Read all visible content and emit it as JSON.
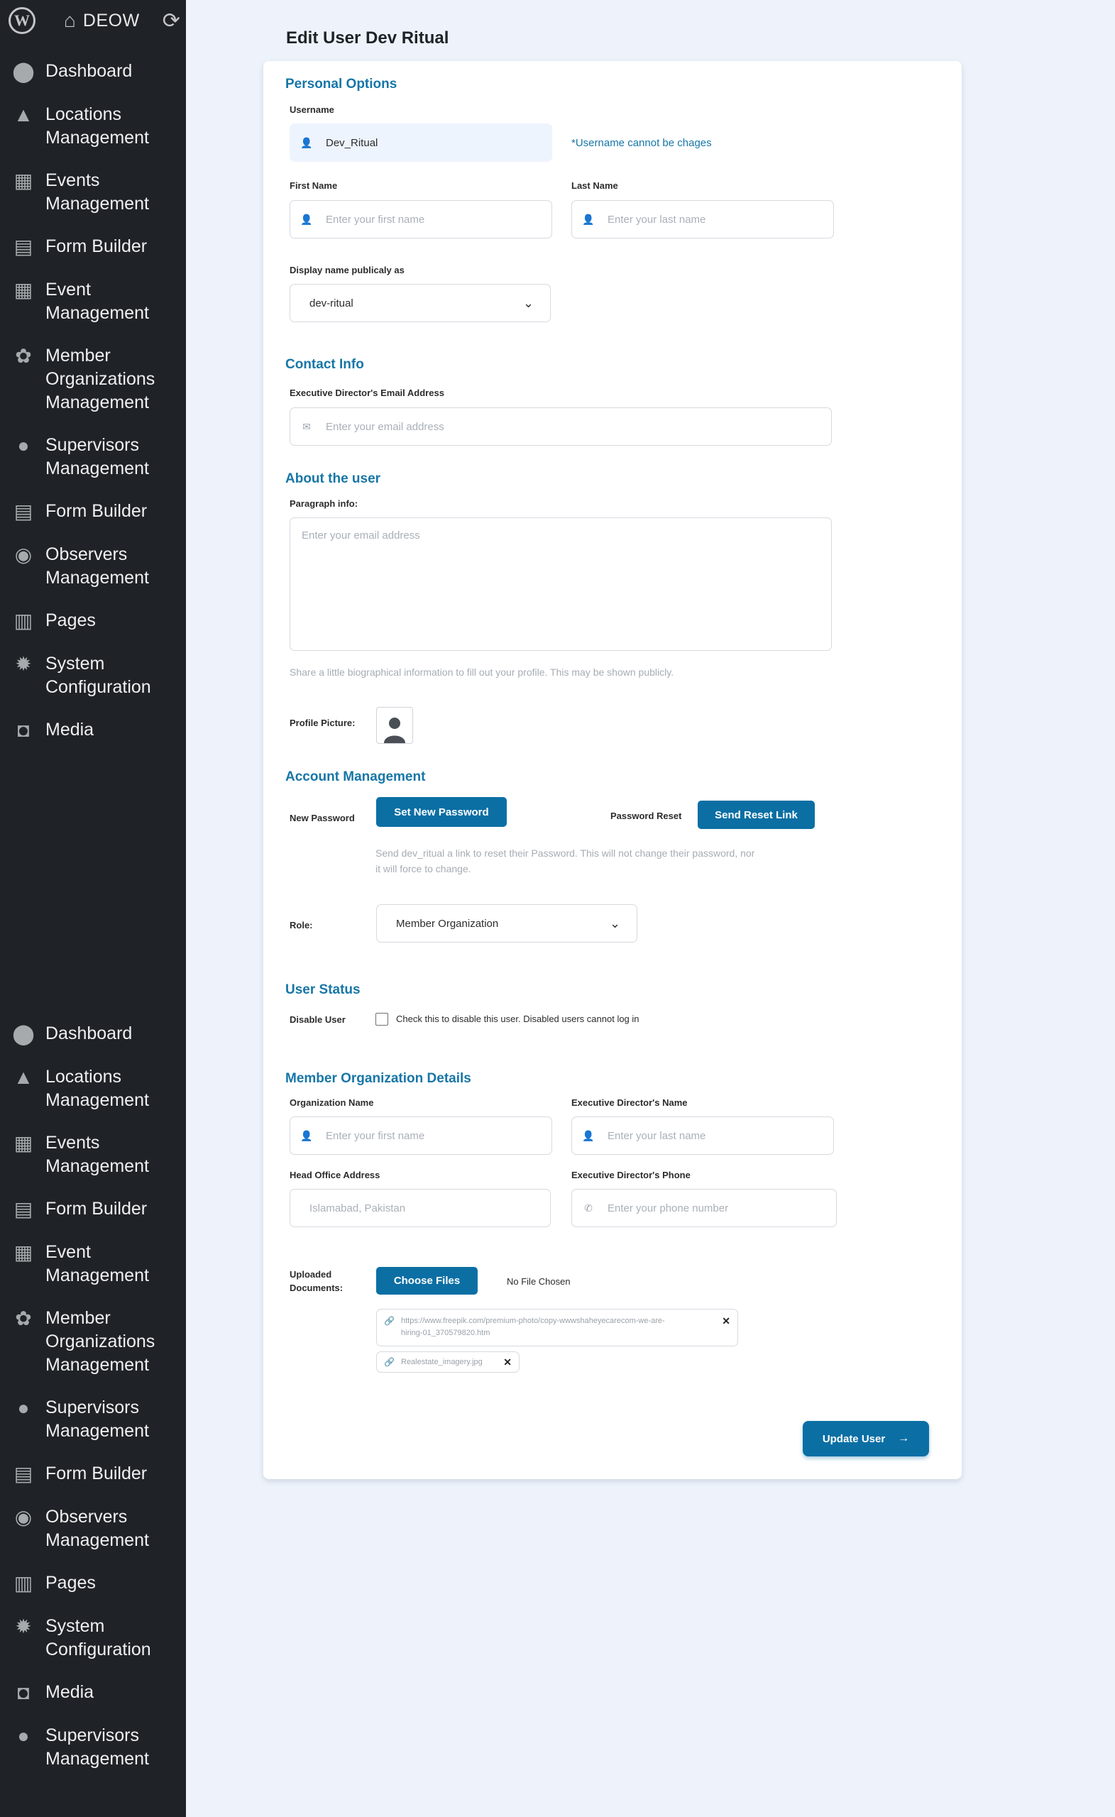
{
  "topbar": {
    "site_name": "DEOW",
    "wp_logo": "W"
  },
  "sidebar": {
    "items": [
      {
        "icon": "⬤",
        "label": "Dashboard"
      },
      {
        "icon": "▲",
        "label": "Locations\nManagement"
      },
      {
        "icon": "▦",
        "label": "Events\nManagement"
      },
      {
        "icon": "▤",
        "label": "Form Builder"
      },
      {
        "icon": "▦",
        "label": "Event\nManagement"
      },
      {
        "icon": "✿",
        "label": "Member\nOrganizations\nManagement"
      },
      {
        "icon": "●",
        "label": "Supervisors\nManagement"
      },
      {
        "icon": "▤",
        "label": "Form Builder"
      },
      {
        "icon": "◉",
        "label": "Observers\nManagement"
      },
      {
        "icon": "▥",
        "label": "Pages"
      },
      {
        "icon": "✹",
        "label": "System\nConfiguration"
      },
      {
        "icon": "◘",
        "label": "Media"
      }
    ],
    "items2": [
      {
        "icon": "⬤",
        "label": "Dashboard"
      },
      {
        "icon": "▲",
        "label": "Locations\nManagement"
      },
      {
        "icon": "▦",
        "label": "Events\nManagement"
      },
      {
        "icon": "▤",
        "label": "Form Builder"
      },
      {
        "icon": "▦",
        "label": "Event\nManagement"
      },
      {
        "icon": "✿",
        "label": "Member\nOrganizations\nManagement"
      },
      {
        "icon": "●",
        "label": "Supervisors\nManagement"
      },
      {
        "icon": "▤",
        "label": "Form Builder"
      },
      {
        "icon": "◉",
        "label": "Observers\nManagement"
      },
      {
        "icon": "▥",
        "label": "Pages"
      },
      {
        "icon": "✹",
        "label": "System\nConfiguration"
      },
      {
        "icon": "◘",
        "label": "Media"
      },
      {
        "icon": "●",
        "label": "Supervisors\nManagement"
      }
    ]
  },
  "page": {
    "title": "Edit User Dev Ritual"
  },
  "personal": {
    "heading": "Personal Options",
    "username_label": "Username",
    "username_value": "Dev_Ritual",
    "username_note": "*Username cannot be chages",
    "first_name_label": "First Name",
    "first_name_placeholder": "Enter your first name",
    "last_name_label": "Last Name",
    "last_name_placeholder": "Enter your last name",
    "display_name_label": "Display name publicaly as",
    "display_name_value": "dev-ritual"
  },
  "contact": {
    "heading": "Contact Info",
    "email_label": "Executive Director's Email Address",
    "email_placeholder": "Enter your email address"
  },
  "about": {
    "heading": "About the user",
    "paragraph_label": "Paragraph info:",
    "paragraph_placeholder": "Enter your email address",
    "help": "Share a little biographical information to fill out your profile. This may be shown publicly.",
    "profile_picture_label": "Profile Picture:"
  },
  "account": {
    "heading": "Account Management",
    "new_password_label": "New Password",
    "set_password_button": "Set New Password",
    "password_reset_label": "Password Reset",
    "send_reset_button": "Send Reset Link",
    "reset_help": "Send dev_ritual a link to reset their Password. This will not change their password, nor\nit will force to change.",
    "role_label": "Role:",
    "role_value": "Member Organization"
  },
  "status": {
    "heading": "User Status",
    "disable_label": "Disable User",
    "disable_text": "Check this to disable this user. Disabled users cannot log in"
  },
  "org": {
    "heading": "Member Organization Details",
    "org_name_label": "Organization Name",
    "org_name_placeholder": "Enter your first name",
    "director_name_label": "Executive Director's Name",
    "director_name_placeholder": "Enter your last name",
    "address_label": "Head Office Address",
    "address_placeholder": "Islamabad, Pakistan",
    "phone_label": "Executive Director's Phone",
    "phone_placeholder": "Enter your phone number",
    "docs_label": "Uploaded\nDocuments:",
    "choose_button": "Choose Files",
    "no_file": "No File Chosen",
    "file1": "https://www.freepik.com/premium-photo/copy-wwwshaheyecarecom-we-are-\nhiring-01_370579820.htm",
    "file2": "Realestate_imagery.jpg"
  },
  "footer": {
    "update_button": "Update User"
  }
}
